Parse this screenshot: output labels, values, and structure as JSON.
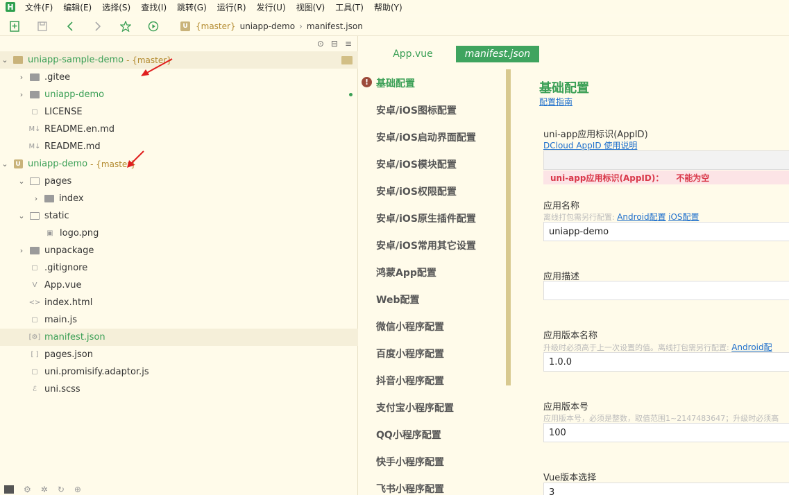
{
  "menubar": {
    "logo": "H",
    "items": [
      "文件(F)",
      "编辑(E)",
      "选择(S)",
      "查找(I)",
      "跳转(G)",
      "运行(R)",
      "发行(U)",
      "视图(V)",
      "工具(T)",
      "帮助(Y)"
    ]
  },
  "breadcrumb": {
    "logo": "U",
    "branch": "{master}",
    "project": "uniapp-demo",
    "file": "manifest.json"
  },
  "tree": {
    "project1": {
      "name": "uniapp-sample-demo",
      "branch": "- {master}"
    },
    "project2": {
      "name": "uniapp-demo",
      "branch": "- {master}"
    },
    "items": {
      "gitee": ".gitee",
      "uniapp_demo": "uniapp-demo",
      "license": "LICENSE",
      "readme_en": "README.en.md",
      "readme": "README.md",
      "pages": "pages",
      "index": "index",
      "static": "static",
      "logo": "logo.png",
      "unpackage": "unpackage",
      "gitignore": ".gitignore",
      "appvue": "App.vue",
      "indexhtml": "index.html",
      "mainjs": "main.js",
      "manifest": "manifest.json",
      "pagesjson": "pages.json",
      "adaptor": "uni.promisify.adaptor.js",
      "scss": "uni.scss"
    }
  },
  "tabs": {
    "app": "App.vue",
    "manifest": "manifest.json"
  },
  "nav": {
    "items": [
      "基础配置",
      "安卓/iOS图标配置",
      "安卓/iOS启动界面配置",
      "安卓/iOS模块配置",
      "安卓/iOS权限配置",
      "安卓/iOS原生插件配置",
      "安卓/iOS常用其它设置",
      "鸿蒙App配置",
      "Web配置",
      "微信小程序配置",
      "百度小程序配置",
      "抖音小程序配置",
      "支付宝小程序配置",
      "QQ小程序配置",
      "快手小程序配置",
      "飞书小程序配置"
    ]
  },
  "form": {
    "title": "基础配置",
    "guide_link": "配置指南",
    "appid_label": "uni-app应用标识(AppID)",
    "appid_link": "DCloud AppID 使用说明",
    "appid_value": "",
    "error_label": "uni-app应用标识(AppID)：",
    "error_msg": "不能为空",
    "name_label": "应用名称",
    "name_hint": "离线打包需另行配置:",
    "android_link": "Android配置",
    "ios_link": "iOS配置",
    "name_value": "uniapp-demo",
    "desc_label": "应用描述",
    "desc_value": "",
    "version_name_label": "应用版本名称",
    "version_name_hint": "升级时必须高于上一次设置的值。离线打包需另行配置:",
    "version_name_link": "Android配",
    "version_name_value": "1.0.0",
    "version_code_label": "应用版本号",
    "version_code_hint": "应用版本号，必须是整数，取值范围1~2147483647；升级时必须高",
    "version_code_value": "100",
    "vue_label": "Vue版本选择",
    "vue_value": "3"
  }
}
